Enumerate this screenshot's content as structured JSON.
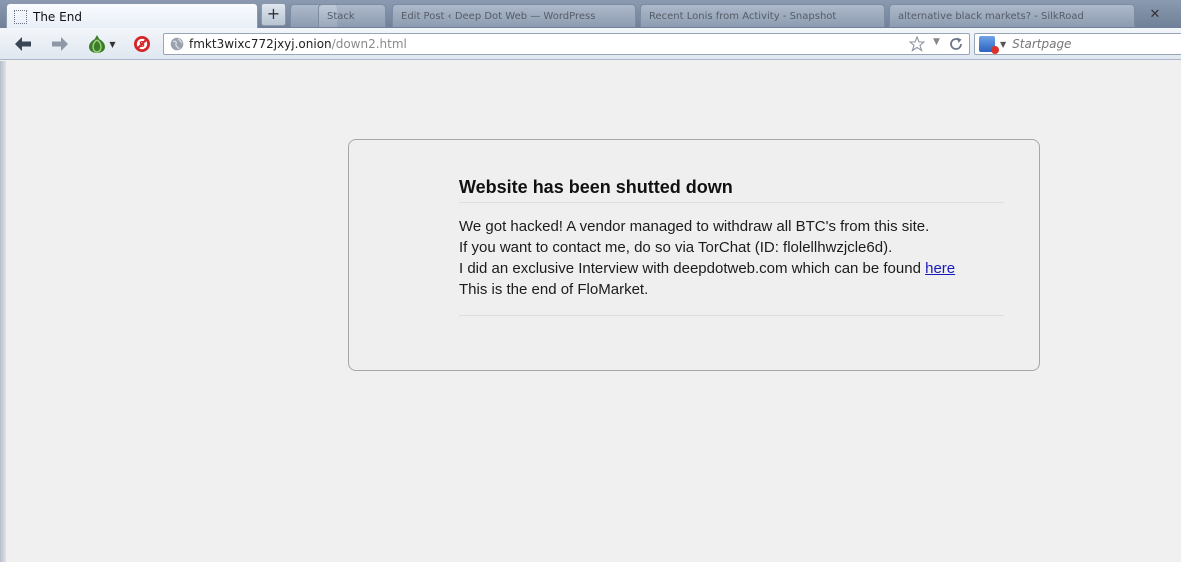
{
  "browser": {
    "active_tab_title": "The End",
    "new_tab_symbol": "+",
    "background_tabs": [
      "",
      "Stack",
      "Edit Post ‹ Deep Dot Web — WordPress",
      "Recent Lonis from Activity - Snapshot",
      "alternative black markets? - SilkRoad"
    ],
    "close_symbol": "✕",
    "url_host": "fmkt3wixc772jxyj.onion",
    "url_path": "/down2.html",
    "search_placeholder": "Startpage",
    "icons": {
      "back": "back-arrow-icon",
      "forward": "forward-arrow-icon",
      "tor": "tor-onion-icon",
      "noscript": "noscript-icon",
      "site": "globe-icon",
      "bookmark": "star-icon",
      "reload": "reload-icon"
    }
  },
  "page": {
    "heading": "Website has been shutted down",
    "line1": "We got hacked! A vendor managed to withdraw all BTC's from this site.",
    "line2": "If you want to contact me, do so via TorChat (ID: flolellhwzjcle6d).",
    "line3_text": "I did an exclusive Interview with deepdotweb.com which can be found ",
    "line3_link": "here",
    "line4": "This is the end of FloMarket."
  },
  "colors": {
    "page_background": "#f0f0f0",
    "link": "#1a1ab8",
    "box_border": "#a6a6a6"
  }
}
